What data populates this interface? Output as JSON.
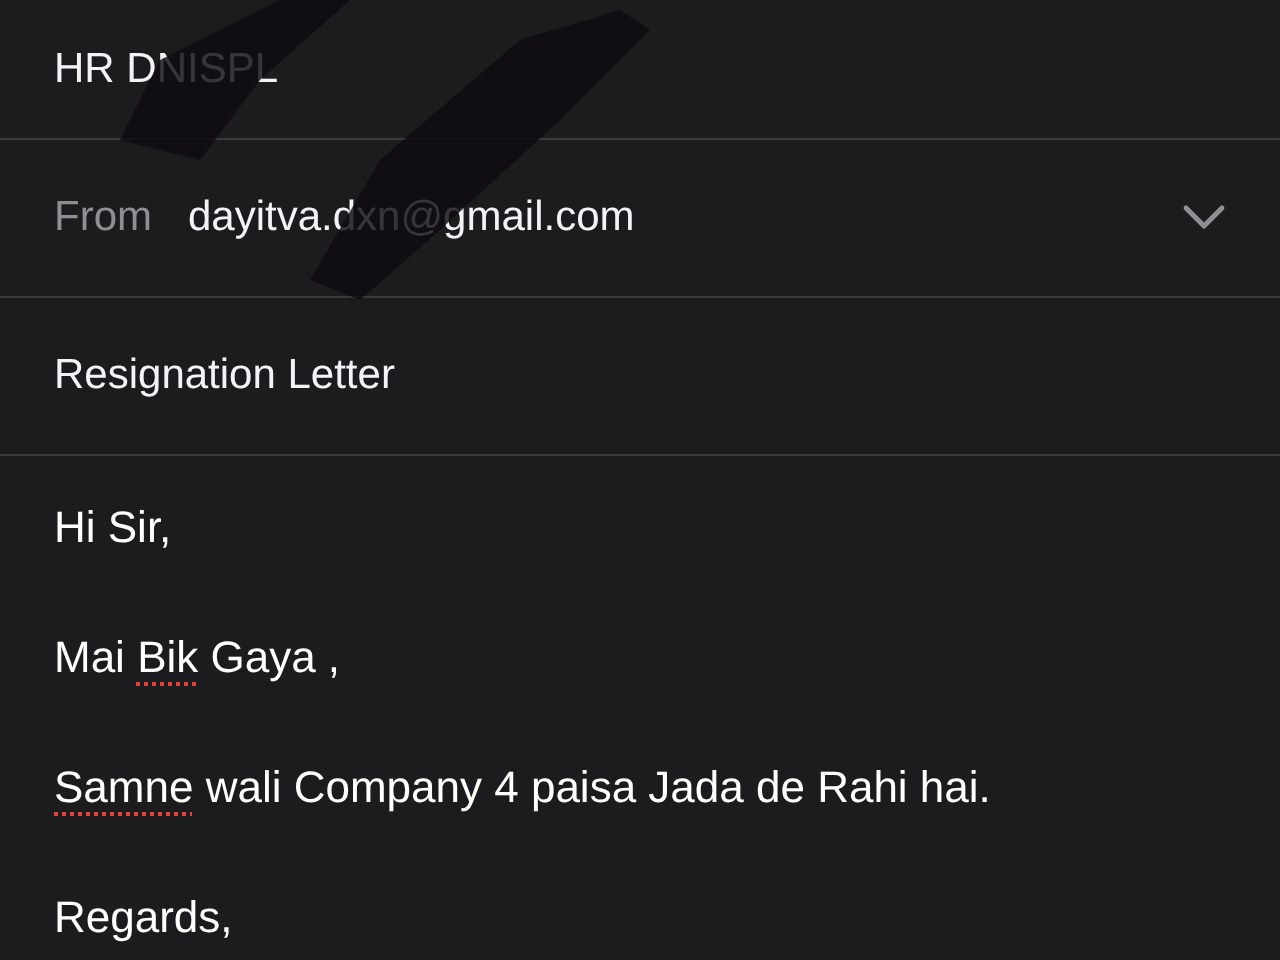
{
  "to": {
    "value": "HR DNISPL"
  },
  "from": {
    "label": "From",
    "value": "dayitva.dxn@gmail.com",
    "expanded": false
  },
  "subject": {
    "value": "Resignation Letter"
  },
  "body": [
    {
      "segments": [
        {
          "text": "Hi Sir,",
          "misspelled": false
        }
      ]
    },
    {
      "segments": [
        {
          "text": "Mai ",
          "misspelled": false
        },
        {
          "text": "Bik",
          "misspelled": true
        },
        {
          "text": " Gaya ,",
          "misspelled": false
        }
      ]
    },
    {
      "segments": [
        {
          "text": "Samne",
          "misspelled": true
        },
        {
          "text": " wali Company 4 paisa Jada de Rahi hai.",
          "misspelled": false
        }
      ]
    },
    {
      "segments": [
        {
          "text": "Regards,",
          "misspelled": false
        }
      ]
    }
  ]
}
